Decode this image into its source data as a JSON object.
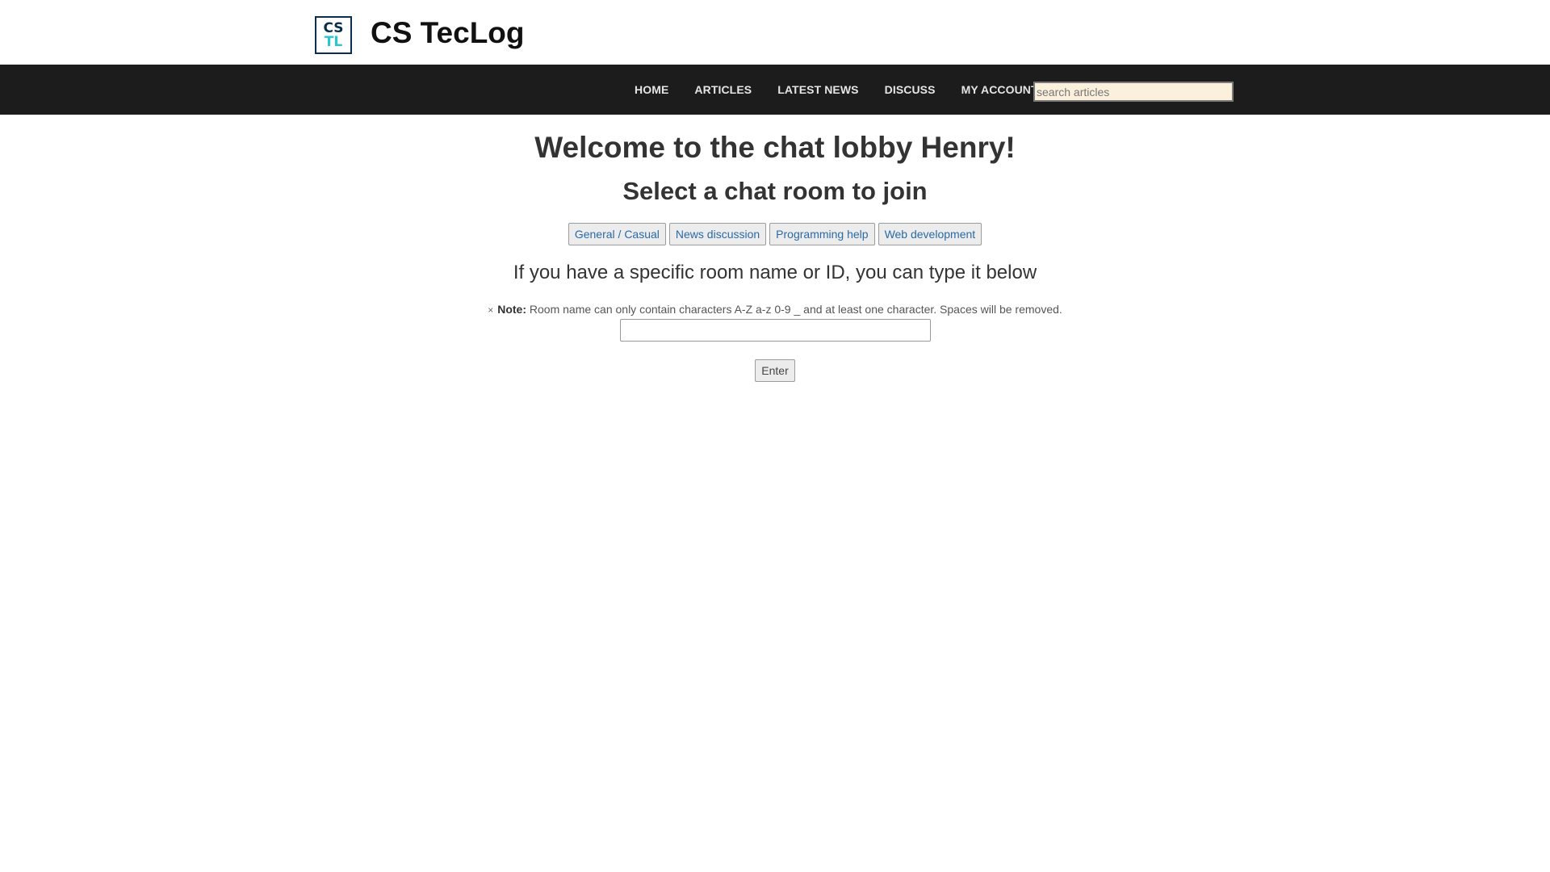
{
  "header": {
    "logo_line1": "CS",
    "logo_line2": "TL",
    "site_title": "CS TecLog"
  },
  "nav": {
    "items": [
      {
        "label": "HOME"
      },
      {
        "label": "ARTICLES"
      },
      {
        "label": "LATEST NEWS"
      },
      {
        "label": "DISCUSS"
      },
      {
        "label": "MY ACCOUNT"
      }
    ],
    "search_placeholder": "search articles"
  },
  "main": {
    "welcome": "Welcome to the chat lobby Henry!",
    "subhead": "Select a chat room to join",
    "rooms": [
      {
        "label": "General / Casual"
      },
      {
        "label": "News discussion"
      },
      {
        "label": "Programming help"
      },
      {
        "label": "Web development"
      }
    ],
    "specific_text": "If you have a specific room name or ID, you can type it below",
    "note_close": "×",
    "note_label": "Note:",
    "note_text": " Room name can only contain characters A-Z a-z 0-9 _ and at least one character. Spaces will be removed.",
    "room_input_value": "",
    "enter_label": "Enter"
  },
  "colors": {
    "navbar_bg": "#1c1c1c",
    "search_bg": "#faf0dc",
    "logo_dark": "#0a2e4e",
    "logo_accent": "#2bc4d2",
    "room_link": "#2a6aa8"
  }
}
